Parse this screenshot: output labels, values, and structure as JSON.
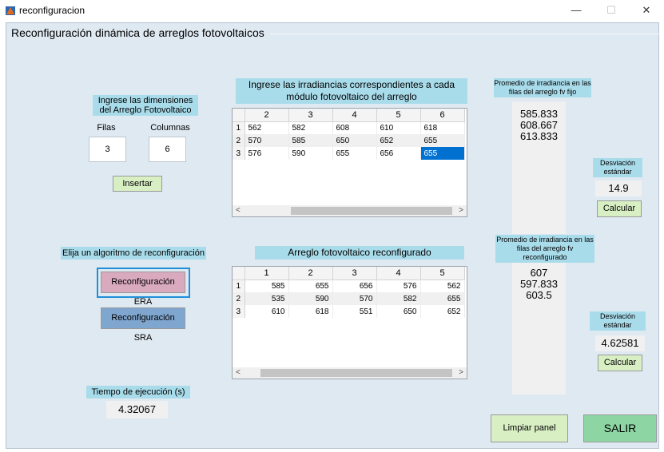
{
  "window": {
    "title": "reconfiguracion",
    "min": "—",
    "max": "☐",
    "close": "✕"
  },
  "panel_title": "Reconfiguración dinámica de arreglos fotovoltaicos",
  "dimensions": {
    "header": "Ingrese las dimensiones del Arreglo Fotovoltaico",
    "filas_label": "Filas",
    "columnas_label": "Columnas",
    "filas_value": "3",
    "columnas_value": "6",
    "insert_label": "Insertar"
  },
  "irradiance_table": {
    "header": "Ingrese las irradiancias correspondientes a cada módulo fotovoltaico del arreglo",
    "columns": [
      "2",
      "3",
      "4",
      "5",
      "6"
    ],
    "rows": [
      {
        "n": "1",
        "cells": [
          "562",
          "582",
          "608",
          "610",
          "618"
        ]
      },
      {
        "n": "2",
        "cells": [
          "570",
          "585",
          "650",
          "652",
          "655"
        ]
      },
      {
        "n": "3",
        "cells": [
          "576",
          "590",
          "655",
          "656",
          "655"
        ]
      }
    ]
  },
  "fixed_avg": {
    "header": "Promedio de irradiancia en las filas del arreglo fv fijo",
    "values": [
      "585.833",
      "608.667",
      "613.833"
    ]
  },
  "fixed_std": {
    "label": "Desviación estándar",
    "value": "14.9",
    "button": "Calcular"
  },
  "algorithm": {
    "header": "Elija un algoritmo de reconfiguración",
    "era_label": "Reconfiguración ERA",
    "sra_label": "Reconfiguración SRA"
  },
  "reconfigured_table": {
    "header": "Arreglo fotovoltaico reconfigurado",
    "columns": [
      "1",
      "2",
      "3",
      "4",
      "5"
    ],
    "rows": [
      {
        "n": "1",
        "cells": [
          "585",
          "655",
          "656",
          "576",
          "562"
        ]
      },
      {
        "n": "2",
        "cells": [
          "535",
          "590",
          "570",
          "582",
          "655"
        ]
      },
      {
        "n": "3",
        "cells": [
          "610",
          "618",
          "551",
          "650",
          "652"
        ]
      }
    ]
  },
  "reconf_avg": {
    "header": "Promedio de irradiancia en las filas del arreglo fv reconfigurado",
    "values": [
      "607",
      "597.833",
      "603.5"
    ]
  },
  "reconf_std": {
    "label": "Desviación estándar",
    "value": "4.62581",
    "button": "Calcular"
  },
  "exec_time": {
    "label": "Tiempo de ejecución (s)",
    "value": "4.32067"
  },
  "clear_label": "Limpiar panel",
  "exit_label": "SALIR",
  "colors": {
    "panel_bg": "#dfe9f2",
    "label_bg": "#a9dceb",
    "era_btn": "#d9a9be",
    "sra_btn": "#7fa6cf",
    "clear_btn": "#d8efc4",
    "exit_btn": "#8dd6a3",
    "selection": "#0070d1"
  }
}
